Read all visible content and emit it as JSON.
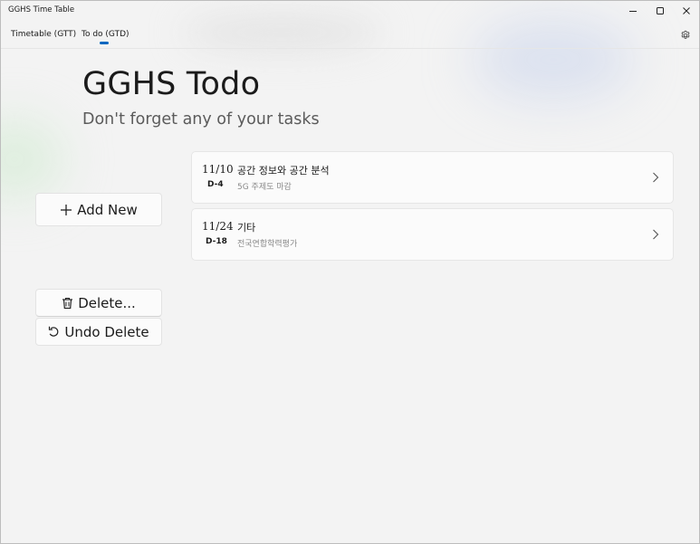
{
  "window": {
    "title": "GGHS Time Table",
    "controls": [
      "minimize-icon",
      "maximize-icon",
      "close-icon"
    ]
  },
  "nav": {
    "tabs": [
      {
        "label": "Timetable (GTT)",
        "selected": false
      },
      {
        "label": "To do (GTD)",
        "selected": true
      }
    ],
    "settings_icon": "gear-icon",
    "accent": "#0067c0"
  },
  "page": {
    "title": "GGHS Todo",
    "subtitle": "Don't forget any of your tasks"
  },
  "actions": {
    "add_label": "Add New",
    "add_icon": "plus-icon",
    "delete_label": "Delete...",
    "delete_icon": "trash-icon",
    "undo_label": "Undo Delete",
    "undo_icon": "undo-icon"
  },
  "todos": [
    {
      "date": "11/10",
      "dday": "D-4",
      "title": "공간 정보와 공간 분석",
      "desc": "5G 주제도 마감"
    },
    {
      "date": "11/24",
      "dday": "D-18",
      "title": "기타",
      "desc": "전국연합학력평가"
    }
  ]
}
